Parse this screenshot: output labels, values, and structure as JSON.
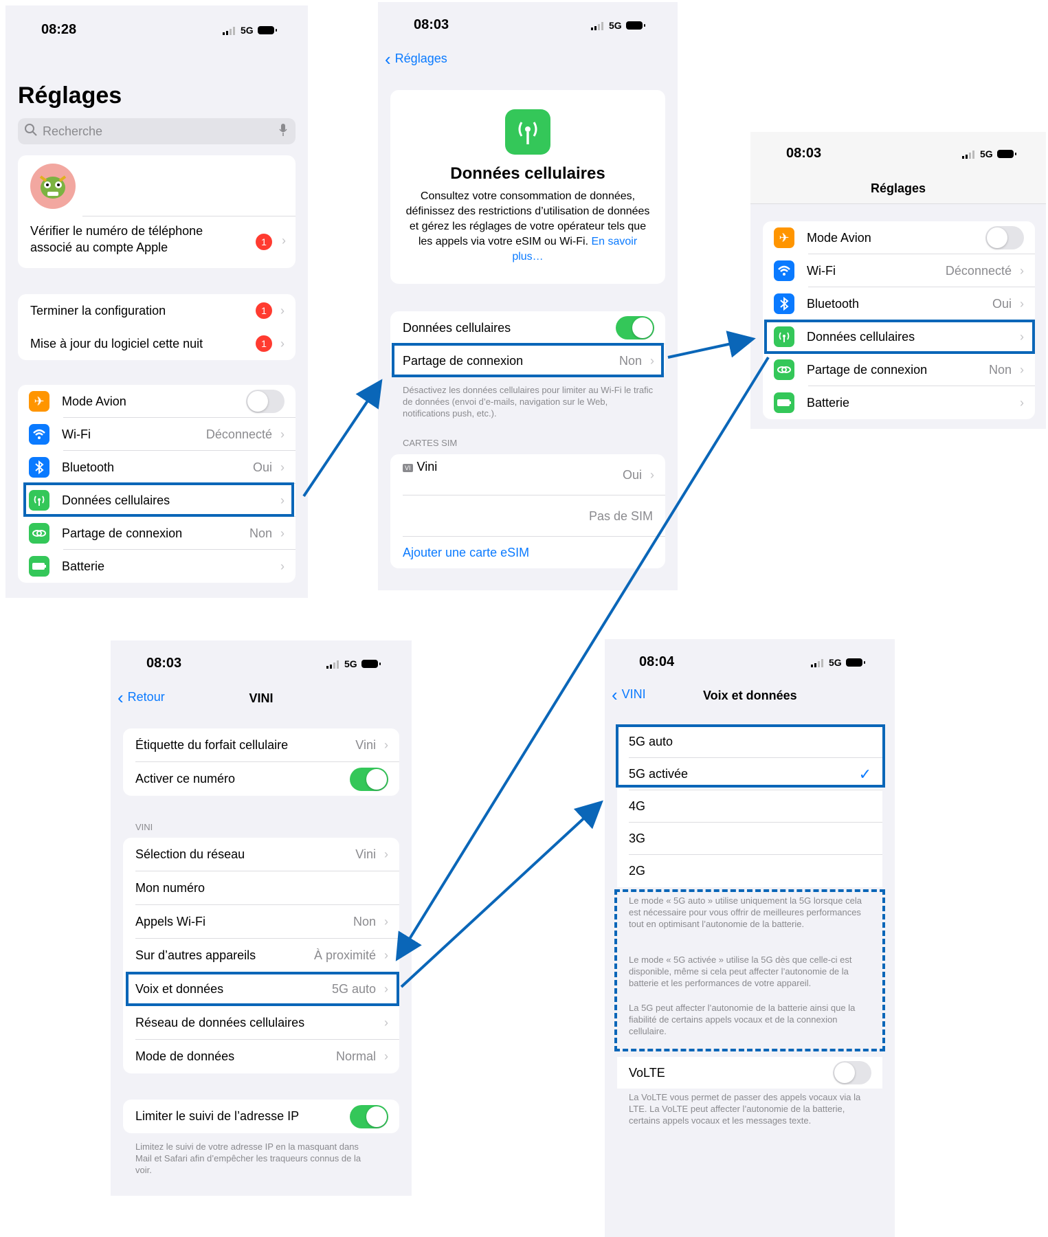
{
  "colors": {
    "accent": "#0a7aff",
    "green": "#34c759",
    "orange": "#ff9500",
    "badge": "#ff3b30",
    "annotation": "#0a66b8"
  },
  "screen1": {
    "time": "08:28",
    "network": "5G",
    "title": "Réglages",
    "search_placeholder": "Recherche",
    "account_notice": "Vérifier le numéro de téléphone associé au compte Apple",
    "account_badge": "1",
    "setup": [
      {
        "label": "Terminer la configuration",
        "badge": "1"
      },
      {
        "label": "Mise à jour du logiciel cette nuit",
        "badge": "1"
      }
    ],
    "settings": [
      {
        "label": "Mode Avion",
        "value": "",
        "icon": "airplane-icon"
      },
      {
        "label": "Wi-Fi",
        "value": "Déconnecté",
        "icon": "wifi-icon"
      },
      {
        "label": "Bluetooth",
        "value": "Oui",
        "icon": "bluetooth-icon"
      },
      {
        "label": "Données cellulaires",
        "value": "",
        "icon": "antenna-icon"
      },
      {
        "label": "Partage de connexion",
        "value": "Non",
        "icon": "link-icon"
      },
      {
        "label": "Batterie",
        "value": "",
        "icon": "battery-icon"
      }
    ]
  },
  "screen2": {
    "time": "08:03",
    "network": "5G",
    "back": "Réglages",
    "heading": "Données cellulaires",
    "description": "Consultez votre consommation de données, définissez des restrictions d’utilisation de données et gérez les réglages de votre opérateur tels que les appels via votre eSIM ou Wi-Fi.",
    "learn_more": "En savoir plus…",
    "cellular_label": "Données cellulaires",
    "cellular_on": true,
    "hotspot_label": "Partage de connexion",
    "hotspot_value": "Non",
    "footer": "Désactivez les données cellulaires pour limiter au Wi-Fi le trafic de données (envoi d’e-mails, navigation sur le Web, notifications push, etc.).",
    "sim_header": "CARTES SIM",
    "sim_tag": "VI",
    "sim_name": "Vini",
    "sim_value": "Oui",
    "no_sim": "Pas de SIM",
    "add_esim": "Ajouter une carte eSIM"
  },
  "screen3": {
    "time": "08:03",
    "network": "5G",
    "title": "Réglages",
    "settings": [
      {
        "label": "Mode Avion",
        "value": "",
        "icon": "airplane-icon"
      },
      {
        "label": "Wi-Fi",
        "value": "Déconnecté",
        "icon": "wifi-icon"
      },
      {
        "label": "Bluetooth",
        "value": "Oui",
        "icon": "bluetooth-icon"
      },
      {
        "label": "Données cellulaires",
        "value": "",
        "icon": "antenna-icon"
      },
      {
        "label": "Partage de connexion",
        "value": "Non",
        "icon": "link-icon"
      },
      {
        "label": "Batterie",
        "value": "",
        "icon": "battery-icon"
      }
    ]
  },
  "screen4": {
    "time": "08:03",
    "network": "5G",
    "back": "Retour",
    "title": "VINI",
    "plan_label": "Étiquette du forfait cellulaire",
    "plan_value": "Vini",
    "activate_label": "Activer ce numéro",
    "section": "VINI",
    "rows": [
      {
        "label": "Sélection du réseau",
        "value": "Vini",
        "chevron": true
      },
      {
        "label": "Mon numéro",
        "value": "",
        "chevron": false
      },
      {
        "label": "Appels Wi-Fi",
        "value": "Non",
        "chevron": true
      },
      {
        "label": "Sur d’autres appareils",
        "value": "À proximité",
        "chevron": true
      },
      {
        "label": "Voix et données",
        "value": "5G auto",
        "chevron": true
      },
      {
        "label": "Réseau de données cellulaires",
        "value": "",
        "chevron": true
      },
      {
        "label": "Mode de données",
        "value": "Normal",
        "chevron": true
      }
    ],
    "ip_label": "Limiter le suivi de l’adresse IP",
    "ip_footer": "Limitez le suivi de votre adresse IP en la masquant dans Mail et Safari afin d’empêcher les traqueurs connus de la voir."
  },
  "screen5": {
    "time": "08:04",
    "network": "5G",
    "back": "VINI",
    "title": "Voix et données",
    "options": [
      "5G auto",
      "5G activée",
      "4G",
      "3G",
      "2G"
    ],
    "selected": "5G activée",
    "note1": "Le mode « 5G auto » utilise uniquement la 5G lorsque cela est nécessaire pour vous offrir de meilleures performances tout en optimisant l’autonomie de la batterie.",
    "note2": "Le mode « 5G activée » utilise la 5G dès que celle-ci est disponible, même si cela peut affecter l’autonomie de la batterie et les performances de votre appareil.",
    "note3": "La 5G peut affecter l’autonomie de la batterie ainsi que la fiabilité de certains appels vocaux et de la connexion cellulaire.",
    "volte_label": "VoLTE",
    "volte_footer": "La VoLTE vous permet de passer des appels vocaux via la LTE. La VoLTE peut affecter l’autonomie de la batterie, certains appels vocaux et les messages texte."
  }
}
